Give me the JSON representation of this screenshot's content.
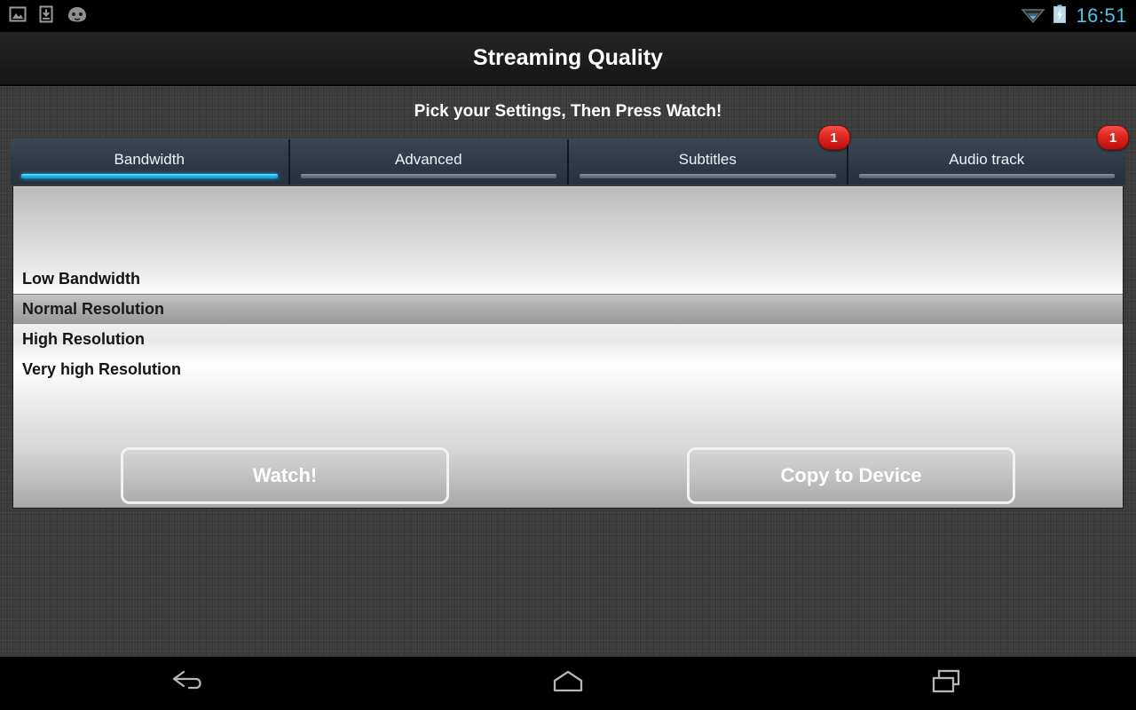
{
  "status_bar": {
    "icons": [
      "image-icon",
      "download-icon",
      "android-head-icon"
    ],
    "wifi_icon": "wifi-icon",
    "battery_icon": "battery-charging-icon",
    "clock": "16:51"
  },
  "action_bar": {
    "title": "Streaming Quality"
  },
  "content": {
    "instruction": "Pick your Settings, Then Press Watch!"
  },
  "tabs": [
    {
      "label": "Bandwidth",
      "active": true,
      "badge": ""
    },
    {
      "label": "Advanced",
      "active": false,
      "badge": ""
    },
    {
      "label": "Subtitles",
      "active": false,
      "badge": "1"
    },
    {
      "label": "Audio track",
      "active": false,
      "badge": "1"
    }
  ],
  "list": {
    "items": [
      {
        "label": "Low Bandwidth",
        "selected": false
      },
      {
        "label": "Normal Resolution",
        "selected": true
      },
      {
        "label": "High Resolution",
        "selected": false
      },
      {
        "label": "Very high Resolution",
        "selected": false
      }
    ]
  },
  "buttons": {
    "watch": "Watch!",
    "copy": "Copy to Device"
  },
  "nav_bar": {
    "back": "back-icon",
    "home": "home-icon",
    "recents": "recents-icon"
  },
  "colors": {
    "accent": "#18b9ef",
    "clock": "#4cc3e8",
    "badge": "#e02a22",
    "background": "#3a3a3a",
    "tab": "#333e4b"
  }
}
